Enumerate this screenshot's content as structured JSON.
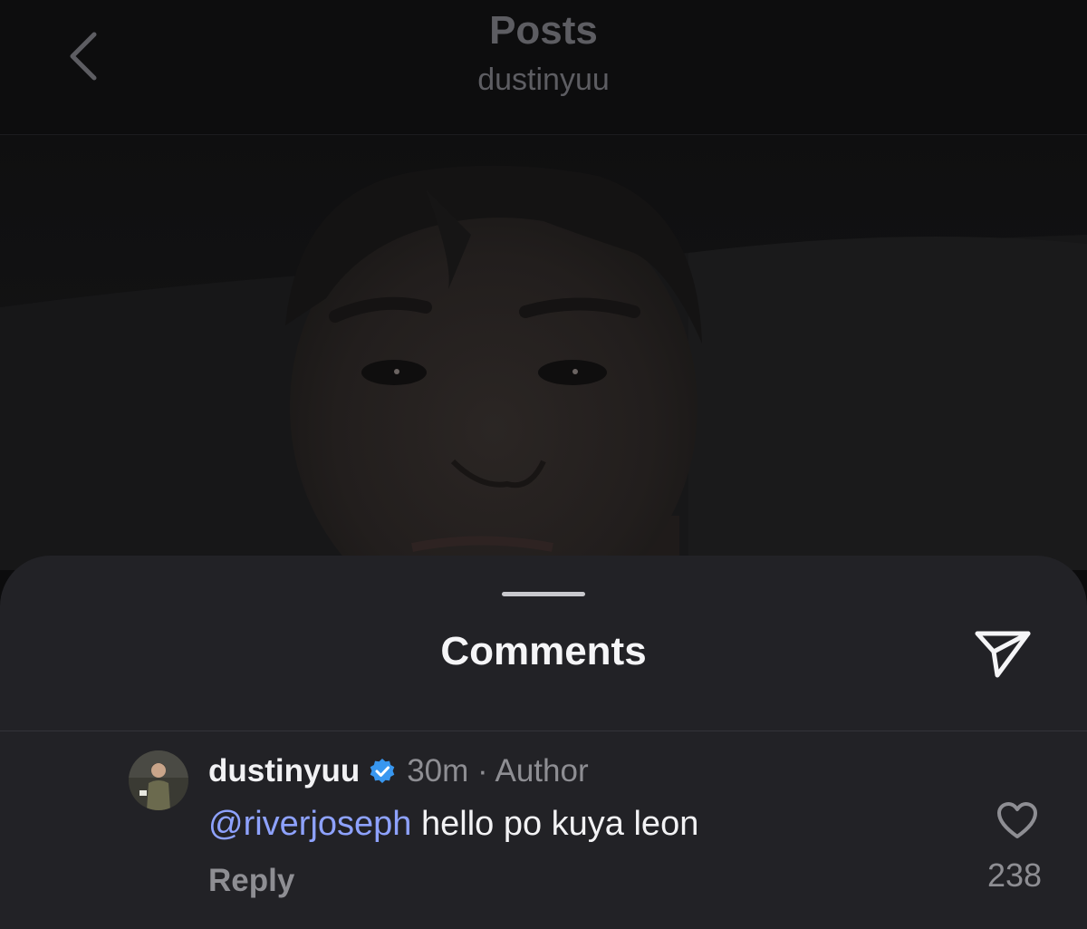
{
  "header": {
    "title": "Posts",
    "subtitle": "dustinyuu",
    "back_icon": "chevron-left-icon"
  },
  "post": {
    "image_description_icon": "selfie-photo"
  },
  "comments_sheet": {
    "title": "Comments",
    "share_icon": "paper-plane-icon"
  },
  "comment": {
    "username": "dustinyuu",
    "verified_icon": "verified-badge-icon",
    "meta": "30m · Author",
    "mention": "@riverjoseph",
    "text": " hello po kuya leon",
    "reply_label": "Reply",
    "like_icon": "heart-icon",
    "like_count": "238"
  },
  "colors": {
    "background": "#0c0c0d",
    "sheet": "#222226",
    "mention": "#8ea2ff",
    "verified": "#3897f0",
    "muted_text": "#8e8e93"
  }
}
